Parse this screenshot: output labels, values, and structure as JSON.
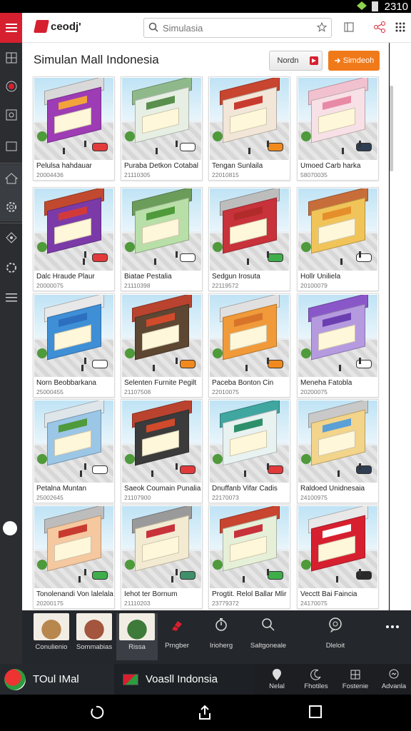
{
  "status": {
    "time": "2310"
  },
  "app": {
    "brand": "ceodj'"
  },
  "search": {
    "placeholder": "Simulasia"
  },
  "page": {
    "title": "Simulan Mall Indonesia"
  },
  "actions": {
    "secondary_label": "Nordn",
    "primary_label": "Simdeoh"
  },
  "cards": [
    {
      "title": "Pelulsa hahdauar",
      "code": "20004436",
      "roof": "#d9d9d9",
      "wall": "#9d3cb5",
      "sign": "#f2a43a",
      "car": "#e23a3a"
    },
    {
      "title": "Puraba Detkon Cotabal",
      "code": "21110305",
      "roof": "#8fb98a",
      "wall": "#e7efe4",
      "sign": "#5a8f4e",
      "car": "#ffffff"
    },
    {
      "title": "Tengan Sunlaila",
      "code": "22010815",
      "roof": "#c8452f",
      "wall": "#f2e6d8",
      "sign": "#c83a2f",
      "car": "#f08a1e"
    },
    {
      "title": "Umoed Carb harka",
      "code": "58070035",
      "roof": "#f2c1cf",
      "wall": "#f7e0e6",
      "sign": "#e889a6",
      "car": "#2f3d52"
    },
    {
      "title": "Dalc Hraude Plaur",
      "code": "20000075",
      "roof": "#c0492f",
      "wall": "#7c3aa8",
      "sign": "#d23a3a",
      "car": "#e23a3a"
    },
    {
      "title": "Biatae Pestalia",
      "code": "21110398",
      "roof": "#6c9c5a",
      "wall": "#b9dfa8",
      "sign": "#4f9a3b",
      "car": "#ffffff"
    },
    {
      "title": "Sedgun Irosuta",
      "code": "22119572",
      "roof": "#bdbdbd",
      "wall": "#c8323a",
      "sign": "#b22b2b",
      "car": "#3fae4a"
    },
    {
      "title": "Hollr Uniliela",
      "code": "20100079",
      "roof": "#c76d3a",
      "wall": "#f1c45a",
      "sign": "#e58f2b",
      "car": "#ffffff"
    },
    {
      "title": "Norn Beobbarkana",
      "code": "25000455",
      "roof": "#e8e8e8",
      "wall": "#3f8fd6",
      "sign": "#2c6ebf",
      "car": "#ffffff"
    },
    {
      "title": "Selenten Furnite Pegilt",
      "code": "21107508",
      "roof": "#b9432f",
      "wall": "#5d4632",
      "sign": "#d24a2c",
      "car": "#f08a1e"
    },
    {
      "title": "Paceba Bonton Cin",
      "code": "22010075",
      "roof": "#e0e0e0",
      "wall": "#f09a3a",
      "sign": "#d8742a",
      "car": "#f08a1e"
    },
    {
      "title": "Meneha Fatobla",
      "code": "20200075",
      "roof": "#8a57c9",
      "wall": "#b59ae0",
      "sign": "#6b3fb0",
      "car": "#ffffff"
    },
    {
      "title": "Petalna Muntan",
      "code": "25002645",
      "roof": "#dfe6ea",
      "wall": "#9bc6e6",
      "sign": "#4f9a3b",
      "car": "#ffffff"
    },
    {
      "title": "Saeok Coumain Punalia",
      "code": "21107900",
      "roof": "#b9432f",
      "wall": "#3b3b3b",
      "sign": "#d24a2c",
      "car": "#e23a3a"
    },
    {
      "title": "Dnuffanb Vifar Cadis",
      "code": "22170073",
      "roof": "#3fa6a0",
      "wall": "#e8f2f0",
      "sign": "#2e8f6b",
      "car": "#e23a3a"
    },
    {
      "title": "Raldoed Unidnesaia",
      "code": "24100975",
      "roof": "#c9c9c9",
      "wall": "#f2d48a",
      "sign": "#5a9fd6",
      "car": "#2f3d52"
    },
    {
      "title": "Tonolenandi Von lalelalan",
      "code": "20200175",
      "roof": "#bdbdbd",
      "wall": "#f5c8a0",
      "sign": "#c83a2f",
      "car": "#3fae4a"
    },
    {
      "title": "Iehot ter Bornum",
      "code": "21110203",
      "roof": "#9a9a9a",
      "wall": "#f3ead2",
      "sign": "#c8323a",
      "car": "#3f8f6b"
    },
    {
      "title": "Progtit. Relol Ballar Mlir",
      "code": "23779372",
      "roof": "#c8452f",
      "wall": "#e6f0d8",
      "sign": "#c8323a",
      "car": "#3fae4a"
    },
    {
      "title": "Vecctt Bai Faincia",
      "code": "24170075",
      "roof": "#e8e8e8",
      "wall": "#d6202f",
      "sign": "#ffffff",
      "car": "#2a2a2a"
    }
  ],
  "toolbar": [
    {
      "label": "Conulienio",
      "kind": "thumb",
      "color": "#b7874e"
    },
    {
      "label": "Sommabias",
      "kind": "thumb",
      "color": "#a3553d"
    },
    {
      "label": "Rissa",
      "kind": "thumb",
      "color": "#3e7a3a"
    },
    {
      "label": "Prngber",
      "kind": "icon",
      "icon": "brush-icon"
    },
    {
      "label": "Irioherg",
      "kind": "icon",
      "icon": "timer-icon"
    },
    {
      "label": "Saltgoneale",
      "kind": "icon",
      "icon": "search-icon"
    },
    {
      "label": "Dleloit",
      "kind": "icon",
      "icon": "chat-icon"
    },
    {
      "label": "",
      "kind": "icon",
      "icon": "more-icon"
    }
  ],
  "dock": {
    "tab1": "TOul IMal",
    "tab2": "Voasll Indonsia",
    "items": [
      {
        "label": "Nelal",
        "icon": "location-icon"
      },
      {
        "label": "Fhotiles",
        "icon": "moon-icon"
      },
      {
        "label": "Fostenie",
        "icon": "grid-icon"
      },
      {
        "label": "Advanla",
        "icon": "chat-bubble-icon"
      }
    ]
  },
  "colors": {
    "brand_red": "#d6202f",
    "accent_orange": "#f07a1a"
  }
}
